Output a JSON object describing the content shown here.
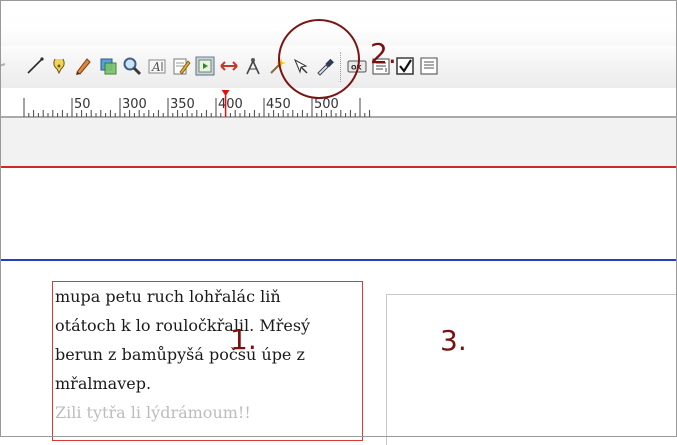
{
  "toolbar": {
    "buttons": [
      {
        "name": "line-tool-icon",
        "title": "Line"
      },
      {
        "name": "bezier-pen-icon",
        "title": "Bezier"
      },
      {
        "name": "freehand-pencil-icon",
        "title": "Freehand"
      },
      {
        "name": "rotate-shape-icon",
        "title": "Rotate"
      },
      {
        "name": "zoom-magnifier-icon",
        "title": "Zoom"
      },
      {
        "name": "text-tool-icon",
        "title": "Text"
      },
      {
        "name": "edit-text-icon",
        "title": "Edit text"
      },
      {
        "name": "link-frames-icon",
        "title": "Link text frames",
        "active": true
      },
      {
        "name": "unlink-frames-icon",
        "title": "Unlink text frames"
      },
      {
        "name": "measure-compass-icon",
        "title": "Measure"
      },
      {
        "name": "magic-wand-icon",
        "title": "Magic wand"
      },
      {
        "name": "copy-properties-icon",
        "title": "Copy properties"
      },
      {
        "name": "eyedropper-icon",
        "title": "Eyedropper"
      },
      {
        "name": "pdf-push-button-icon",
        "title": "PDF push button",
        "text": "OK"
      },
      {
        "name": "pdf-text-field-icon",
        "title": "PDF text field"
      },
      {
        "name": "pdf-checkbox-icon",
        "title": "PDF checkbox"
      },
      {
        "name": "pdf-list-box-icon",
        "title": "PDF list box"
      }
    ]
  },
  "ruler": {
    "labels": [
      "50",
      "300",
      "350",
      "400",
      "450",
      "500"
    ],
    "marker_value": 410
  },
  "frame1": {
    "lines": [
      "mupa petu ruch lohřalác liň",
      "otátoch k lo rouločkřalil. Mřesý",
      "berun z bamůpyšá počsu úpe z",
      "mřalmavep."
    ],
    "faded_line": "Zili tytřa li lýdrámoum!!"
  },
  "callouts": {
    "one": "1.",
    "two": "2.",
    "three": "3."
  },
  "colors": {
    "callout": "#7a1010",
    "red_guide": "#d22828",
    "blue_guide": "#2a3dc8",
    "frame_border": "#d63a3a",
    "ruler_marker": "#e01010"
  }
}
